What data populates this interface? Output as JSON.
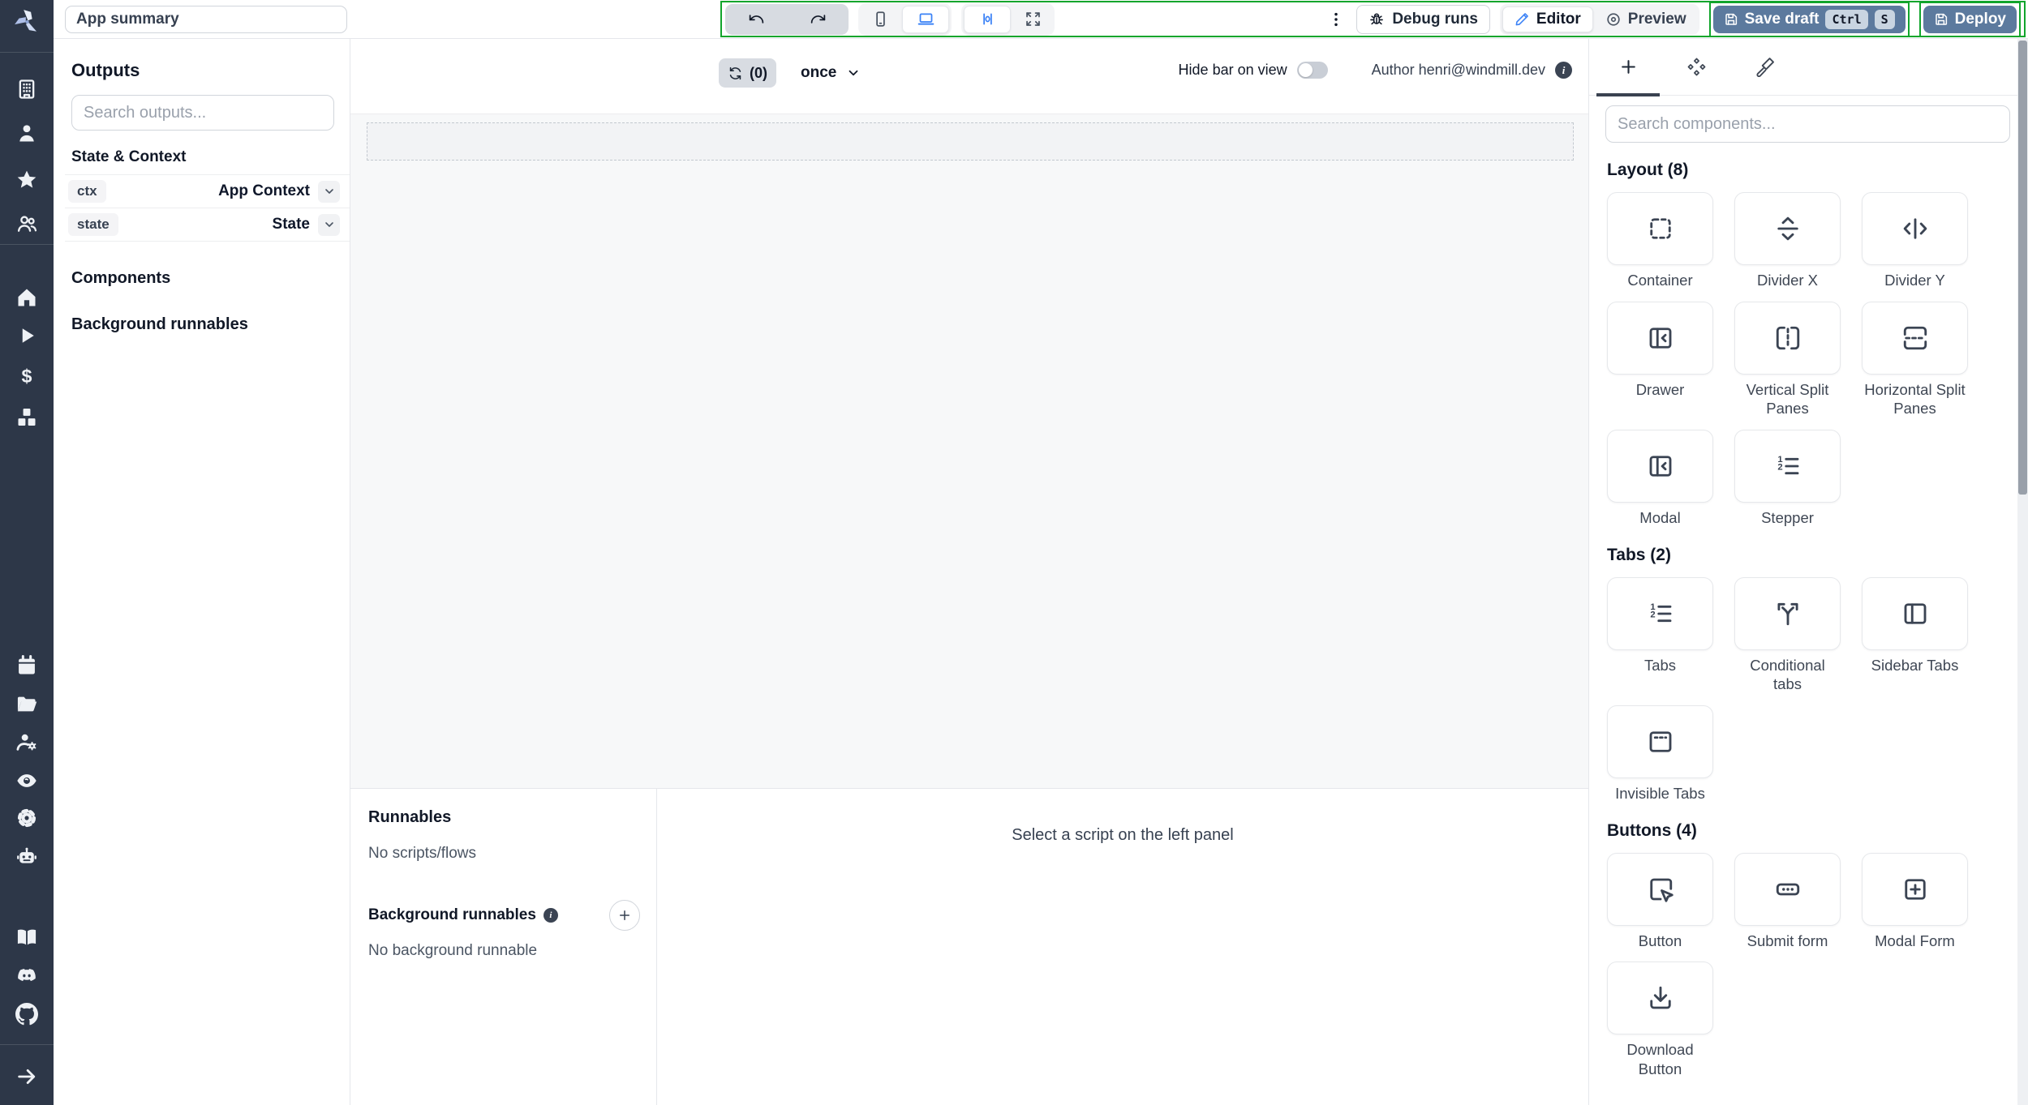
{
  "topbar": {
    "app_summary_value": "App summary",
    "debug_runs_label": "Debug runs",
    "editor_label": "Editor",
    "preview_label": "Preview",
    "save_draft_label": "Save draft",
    "save_draft_kbd": [
      "Ctrl",
      "S"
    ],
    "deploy_label": "Deploy"
  },
  "rail": {
    "items": [
      "building",
      "user",
      "star",
      "users",
      "divider",
      "home",
      "play",
      "dollar",
      "boxes",
      "calendar",
      "folder",
      "user-cog",
      "eye",
      "gear",
      "bot",
      "book",
      "discord",
      "github",
      "divider",
      "arrow-right"
    ]
  },
  "outputs_panel": {
    "title": "Outputs",
    "search_placeholder": "Search outputs...",
    "state_context_title": "State & Context",
    "rows": [
      {
        "key": "ctx",
        "type": "App Context"
      },
      {
        "key": "state",
        "type": "State"
      }
    ],
    "components_title": "Components",
    "background_title": "Background runnables"
  },
  "canvas": {
    "refresh_count": "(0)",
    "refresh_mode": "once",
    "hide_bar_label": "Hide bar on view",
    "author_label": "Author henri@windmill.dev"
  },
  "runnables": {
    "title": "Runnables",
    "empty_scripts": "No scripts/flows",
    "background_title": "Background runnables",
    "empty_background": "No background runnable",
    "select_hint": "Select a script on the left panel"
  },
  "components_panel": {
    "search_placeholder": "Search components...",
    "sections": [
      {
        "title": "Layout (8)",
        "items": [
          {
            "label": "Container",
            "icon": "container"
          },
          {
            "label": "Divider X",
            "icon": "divider-x"
          },
          {
            "label": "Divider Y",
            "icon": "divider-y"
          },
          {
            "label": "Drawer",
            "icon": "drawer"
          },
          {
            "label": "Vertical Split Panes",
            "icon": "v-split"
          },
          {
            "label": "Horizontal Split Panes",
            "icon": "h-split"
          },
          {
            "label": "Modal",
            "icon": "drawer"
          },
          {
            "label": "Stepper",
            "icon": "list-ordered"
          }
        ]
      },
      {
        "title": "Tabs (2)",
        "items": [
          {
            "label": "Tabs",
            "icon": "list-ordered"
          },
          {
            "label": "Conditional tabs",
            "icon": "branch"
          },
          {
            "label": "Sidebar Tabs",
            "icon": "sidebar-tabs"
          },
          {
            "label": "Invisible Tabs",
            "icon": "invisible-tabs"
          }
        ]
      },
      {
        "title": "Buttons (4)",
        "items": [
          {
            "label": "Button",
            "icon": "square-pointer"
          },
          {
            "label": "Submit form",
            "icon": "submit-form"
          },
          {
            "label": "Modal Form",
            "icon": "square-plus"
          },
          {
            "label": "Download Button",
            "icon": "download"
          }
        ]
      }
    ]
  },
  "colors": {
    "rail_bg": "#2d3748",
    "accent_green": "#11a52c",
    "primary_button": "#5c7a9e",
    "active_blue": "#3b82f6"
  }
}
